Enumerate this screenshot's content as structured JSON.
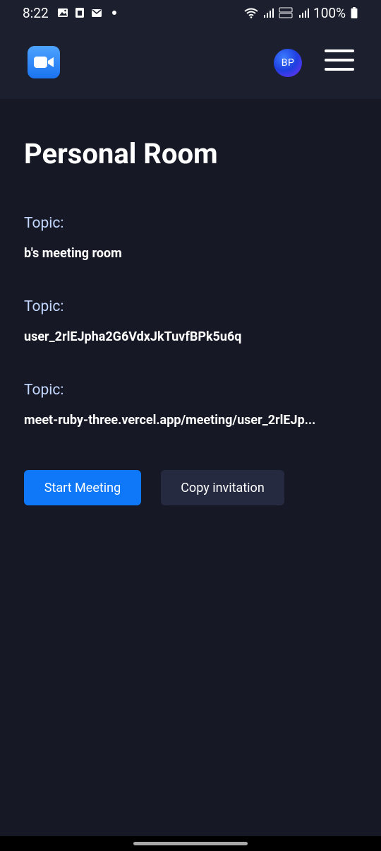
{
  "status_bar": {
    "time": "8:22",
    "battery": "100%",
    "icons_left": [
      "gallery-icon",
      "sim-icon",
      "mail-icon",
      "notification-dot"
    ],
    "icons_right": [
      "wifi-icon",
      "signal-icon",
      "volte-lte2-icon",
      "signal-icon-2",
      "battery-icon"
    ]
  },
  "header": {
    "logo_icon": "video-camera-icon",
    "avatar_initials": "BP",
    "menu_icon": "hamburger-menu-icon"
  },
  "main": {
    "title": "Personal Room",
    "fields": [
      {
        "label": "Topic:",
        "value": "b's meeting room"
      },
      {
        "label": "Topic:",
        "value": "user_2rlEJpha2G6VdxJkTuvfBPk5u6q"
      },
      {
        "label": "Topic:",
        "value": "meet-ruby-three.vercel.app/meeting/user_2rlEJp..."
      }
    ],
    "start_button": "Start Meeting",
    "copy_button": "Copy invitation"
  },
  "colors": {
    "background": "#161925",
    "header": "#1c1f2e",
    "primary": "#0e78f9",
    "secondary": "#252a41",
    "label": "#c4d7ff"
  }
}
